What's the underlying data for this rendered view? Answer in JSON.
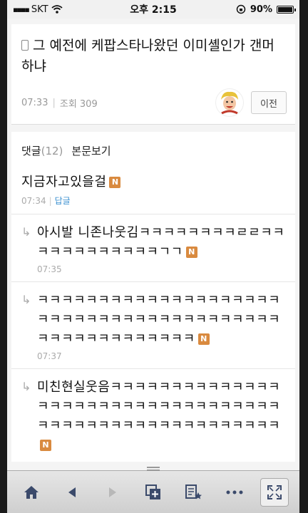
{
  "status_bar": {
    "carrier": "SKT",
    "time": "오후 2:15",
    "battery": "90%",
    "battery_level": 0.9
  },
  "post": {
    "title": "그 예전에 케팝스타나왔던 이미셸인가 갠머하냐",
    "time": "07:33",
    "views": "조회 309",
    "prev_label": "이전",
    "avatar_icon": "cartoon-avatar"
  },
  "comments_tabs": {
    "comments_label": "댓글",
    "comments_count": "(12)",
    "view_post_label": "본문보기"
  },
  "comments": [
    {
      "text": "지금자고있을걸",
      "time": "07:34",
      "reply_label": "답글",
      "is_reply": false,
      "new_badge": "N"
    },
    {
      "text": "아시발 니존나웃김ㅋㅋㅋㅋㅋㅋㅋㅋㄹㄹㅋㅋㅋㅋㅋㅋㅋㅋㅋㅋㅋㅋㄱㄱ",
      "time": "07:35",
      "is_reply": true,
      "new_badge": "N"
    },
    {
      "text": "ㅋㅋㅋㅋㅋㅋㅋㅋㅋㅋㅋㅋㅋㅋㅋㅋㅋㅋㅋㅋㅋㅋㅋㅋㅋㅋㅋㅋㅋㅋㅋㅋㅋㅋㅋㅋㅋㅋㅋㅋㅋㅋㅋㅋㅋㅋㅋㅋㅋㅋㅋㅋㅋ",
      "time": "07:37",
      "is_reply": true,
      "new_badge": "N"
    },
    {
      "text": "미친현실웃음ㅋㅋㅋㅋㅋㅋㅋㅋㅋㅋㅋㅋㅋㅋㅋㅋㅋㅋㅋㅋㅋㅋㅋㅋㅋㅋㅋㅋㅋㅋㅋㅋㅋㅋㅋㅋㅋㅋㅋㅋㅋㅋㅋㅋㅋㅋㅋㅋㅋㅋㅋㅋㅋㅋ",
      "is_reply": true,
      "new_badge": "N"
    }
  ],
  "toolbar": {
    "icons": [
      "home-icon",
      "back-icon",
      "forward-icon",
      "new-window-icon",
      "bookmark-icon",
      "more-icon",
      "fullscreen-icon"
    ]
  }
}
